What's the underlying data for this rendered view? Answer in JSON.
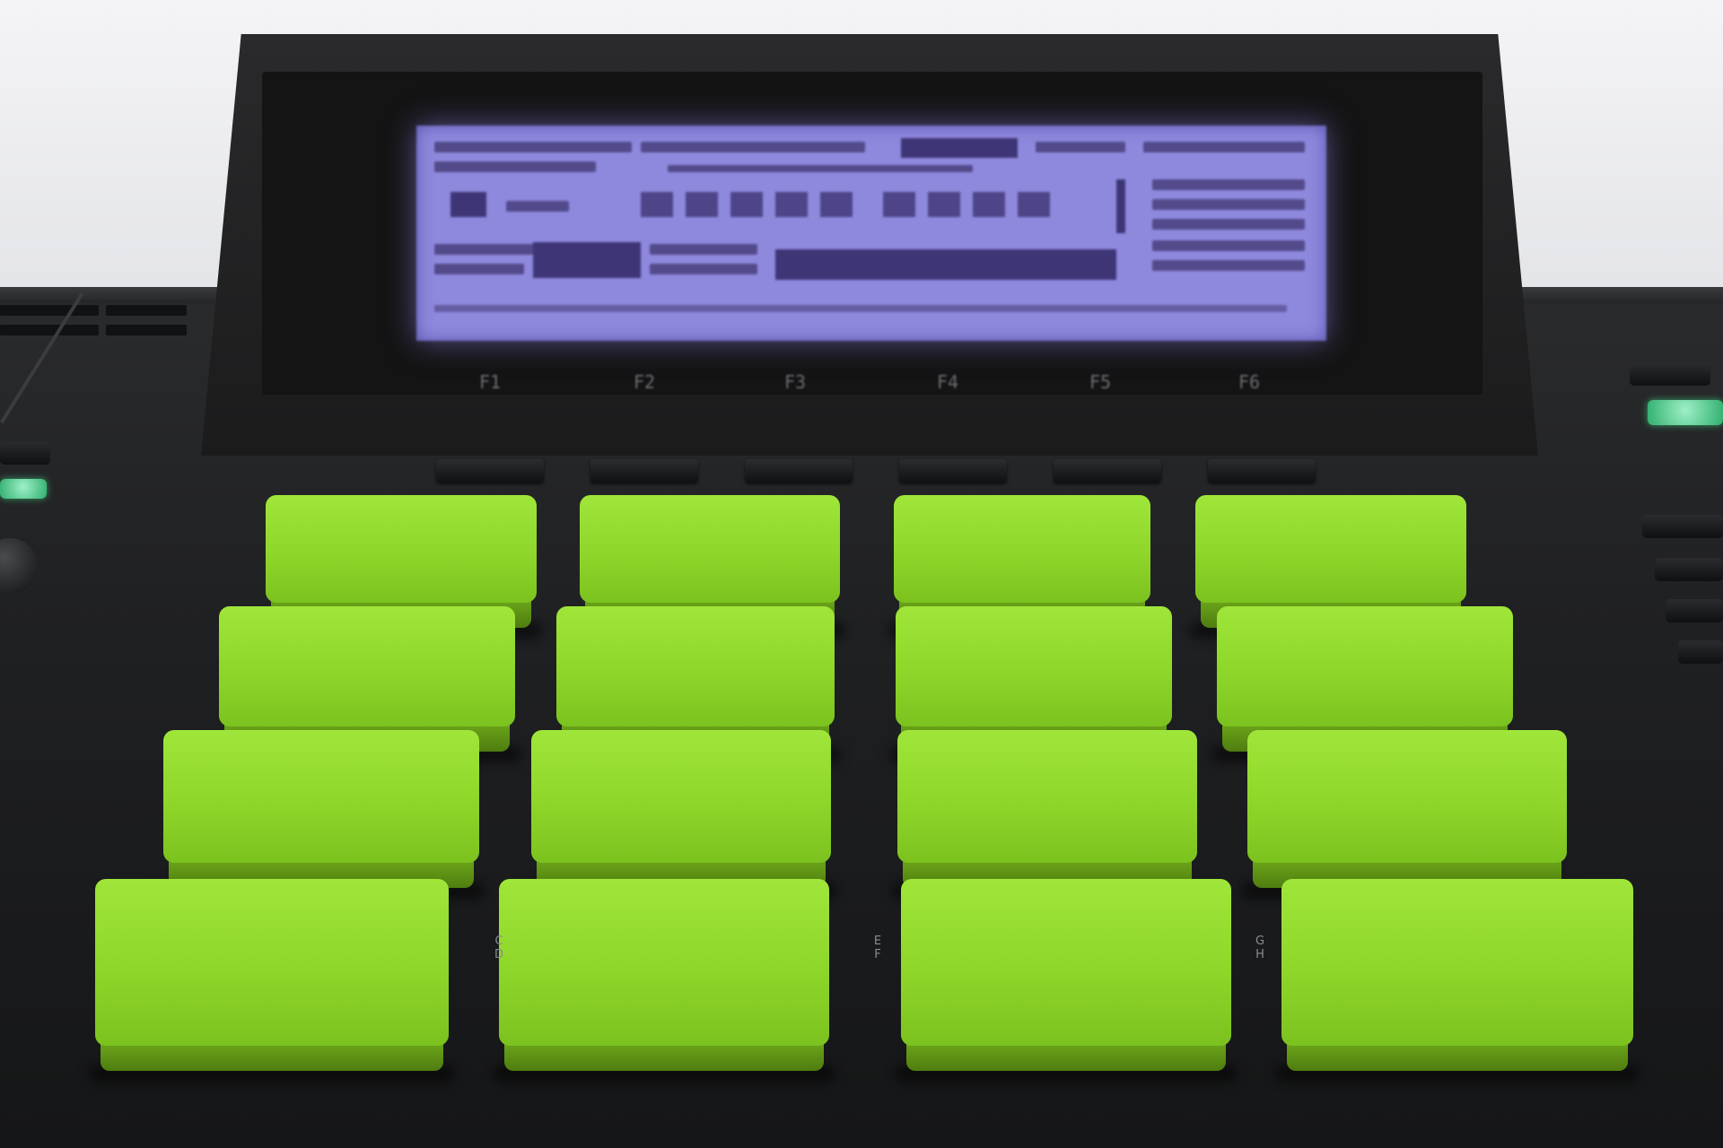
{
  "colors": {
    "pad_green": "#8ed62a",
    "lcd_blue": "#8f89de",
    "body_dark": "#1f2022"
  },
  "screen": {
    "function_labels": [
      "F1",
      "F2",
      "F3",
      "F4",
      "F5",
      "F6"
    ]
  },
  "pads": [
    {
      "id": "pad-1"
    },
    {
      "id": "pad-2"
    },
    {
      "id": "pad-3"
    },
    {
      "id": "pad-4"
    },
    {
      "id": "pad-5"
    },
    {
      "id": "pad-6"
    },
    {
      "id": "pad-7"
    },
    {
      "id": "pad-8"
    },
    {
      "id": "pad-9"
    },
    {
      "id": "pad-10"
    },
    {
      "id": "pad-11"
    },
    {
      "id": "pad-12"
    },
    {
      "id": "pad-13"
    },
    {
      "id": "pad-14"
    },
    {
      "id": "pad-15"
    },
    {
      "id": "pad-16"
    }
  ],
  "pad_labels": {
    "bottom": [
      "C\nD",
      "E\nF",
      "G\nH"
    ]
  }
}
